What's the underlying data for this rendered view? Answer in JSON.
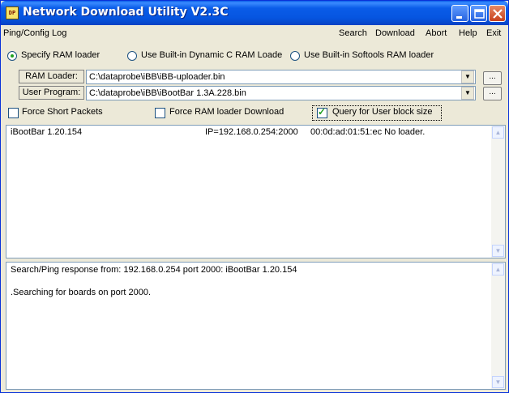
{
  "window": {
    "title": "Network Download Utility V2.3C",
    "icon_text": "DP"
  },
  "menu": {
    "left": [
      "Ping/Config",
      "Log"
    ],
    "right": [
      "Search",
      "Download",
      "Abort",
      "Help",
      "Exit"
    ]
  },
  "radios": [
    {
      "label": "Specify RAM loader",
      "selected": true
    },
    {
      "label": "Use Built-in Dynamic C RAM Loade",
      "selected": false
    },
    {
      "label": "Use Built-in Softools  RAM loader",
      "selected": false
    }
  ],
  "ram_loader": {
    "label": "RAM Loader:",
    "value": "C:\\dataprobe\\iBB\\iBB-uploader.bin",
    "browse": "..."
  },
  "user_program": {
    "label": "User Program:",
    "value": "C:\\dataprobe\\iBB\\iBootBar 1.3A.228.bin",
    "browse": "..."
  },
  "checks": [
    {
      "label": "Force Short Packets",
      "checked": false
    },
    {
      "label": "Force RAM loader Download",
      "checked": false
    },
    {
      "label": "Query for User block size",
      "checked": true
    }
  ],
  "devices": [
    {
      "name": "iBootBar 1.20.154",
      "ip": "IP=192.168.0.254:2000",
      "mac": "00:0d:ad:01:51:ec No loader."
    }
  ],
  "log": [
    "Search/Ping response from: 192.168.0.254 port 2000: iBootBar 1.20.154",
    ".Searching for boards on port 2000."
  ],
  "colors": {
    "title_bar": "#0a5ce8",
    "window_bg": "#ece9d8",
    "check_mark": "#21a121"
  }
}
